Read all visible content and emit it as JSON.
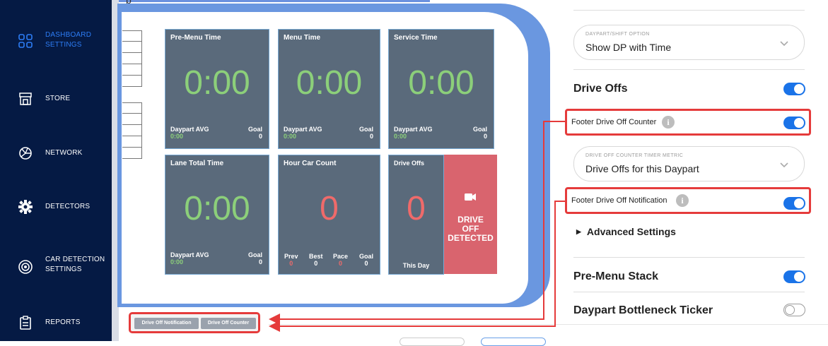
{
  "header": {
    "fragment": "p"
  },
  "sidebar": {
    "items": [
      {
        "label_line1": "DASHBOARD",
        "label_line2": "SETTINGS",
        "icon": "grid-icon",
        "active": true
      },
      {
        "label_line1": "STORE",
        "label_line2": "",
        "icon": "store-icon",
        "active": false
      },
      {
        "label_line1": "NETWORK",
        "label_line2": "",
        "icon": "network-icon",
        "active": false
      },
      {
        "label_line1": "DETECTORS",
        "label_line2": "",
        "icon": "gear-icon",
        "active": false
      },
      {
        "label_line1": "CAR DETECTION",
        "label_line2": "SETTINGS",
        "icon": "radar-icon",
        "active": false
      },
      {
        "label_line1": "REPORTS",
        "label_line2": "",
        "icon": "clipboard-icon",
        "active": false
      }
    ]
  },
  "tiles": {
    "pre_menu": {
      "title": "Pre-Menu Time",
      "value": "0:00",
      "avg_label": "Daypart AVG",
      "avg_value": "0:00",
      "goal_label": "Goal",
      "goal_value": "0"
    },
    "menu": {
      "title": "Menu Time",
      "value": "0:00",
      "avg_label": "Daypart AVG",
      "avg_value": "0:00",
      "goal_label": "Goal",
      "goal_value": "0"
    },
    "service": {
      "title": "Service Time",
      "value": "0:00",
      "avg_label": "Daypart AVG",
      "avg_value": "0:00",
      "goal_label": "Goal",
      "goal_value": "0"
    },
    "lane_total": {
      "title": "Lane Total Time",
      "value": "0:00",
      "avg_label": "Daypart AVG",
      "avg_value": "0:00",
      "goal_label": "Goal",
      "goal_value": "0"
    },
    "hour_count": {
      "title": "Hour Car Count",
      "value": "0",
      "stats": [
        {
          "label": "Prev",
          "value": "0"
        },
        {
          "label": "Best",
          "value": "0"
        },
        {
          "label": "Pace",
          "value": "0"
        },
        {
          "label": "Goal",
          "value": "0"
        }
      ]
    },
    "drive_offs": {
      "title": "Drive Offs",
      "value": "0",
      "footer": "This Day"
    },
    "alert": {
      "line1": "DRIVE",
      "line2": "OFF",
      "line3": "DETECTED",
      "icon": "video-camera-icon"
    }
  },
  "footer_buttons": {
    "notification": "Drive Off Notification",
    "counter": "Drive Off Counter"
  },
  "settings": {
    "daypart_select": {
      "label": "DAYPART/SHIFT OPTION",
      "value": "Show DP with Time"
    },
    "drive_offs": {
      "title": "Drive Offs",
      "on": true
    },
    "footer_counter": {
      "label": "Footer Drive Off Counter",
      "on": true
    },
    "timer_select": {
      "label": "DRIVE OFF COUNTER TIMER METRIC",
      "value": "Drive Offs for this Daypart"
    },
    "footer_notification": {
      "label": "Footer Drive Off Notification",
      "on": true
    },
    "advanced": {
      "label": "Advanced Settings"
    },
    "pre_menu_stack": {
      "title": "Pre-Menu Stack",
      "on": true
    },
    "bottleneck": {
      "title": "Daypart Bottleneck Ticker",
      "on": false
    }
  },
  "colors": {
    "sidebar": "#051a44",
    "accent": "#1a73e8",
    "highlight": "#e53b3b",
    "tile": "#5a6a7b",
    "alert": "#d9646e",
    "time_green": "#8ccf7a",
    "count_red": "#ef6a6a"
  }
}
